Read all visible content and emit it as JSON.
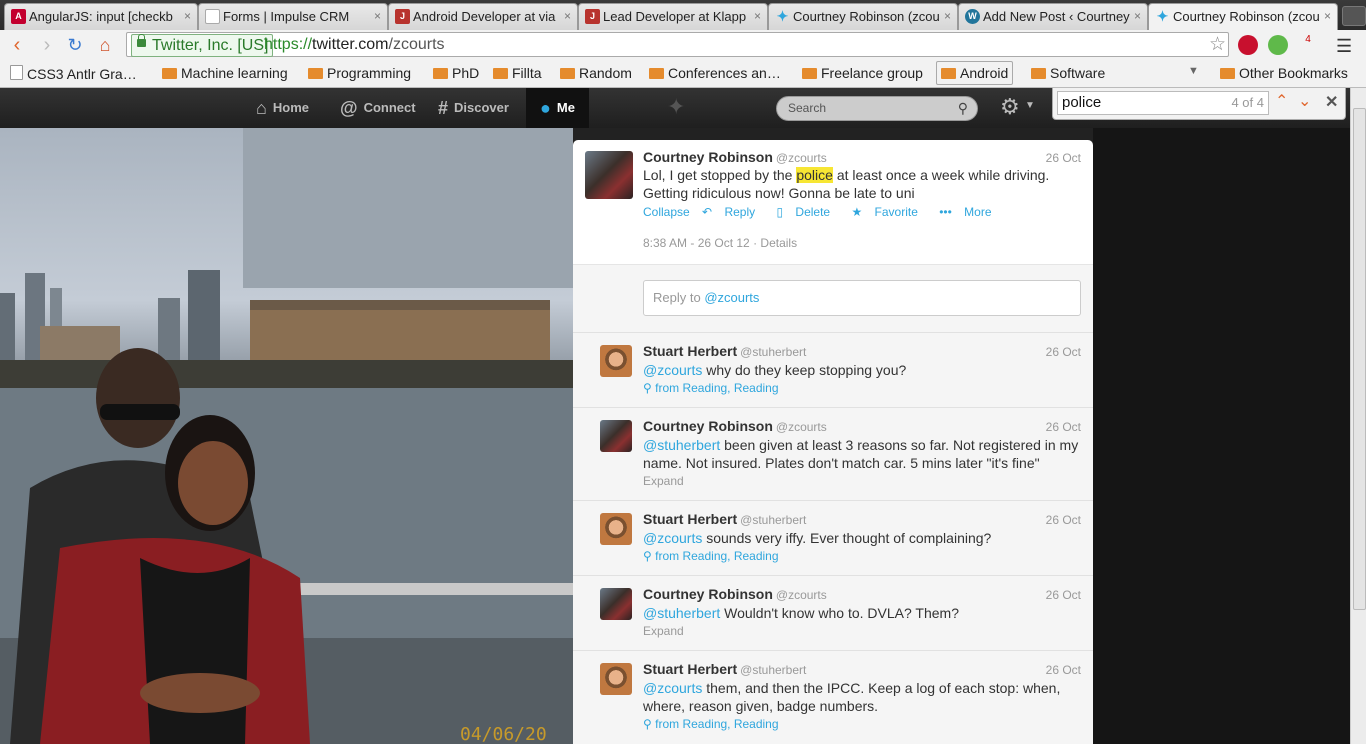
{
  "browser": {
    "tabs": [
      {
        "title": "AngularJS: input [checkb",
        "icon": "angular-icon",
        "color": "#c3002f"
      },
      {
        "title": "Forms | Impulse CRM",
        "icon": "page-icon",
        "color": "#ffffff"
      },
      {
        "title": "Android Developer at via",
        "icon": "jobpage-icon",
        "color": "#b8332e"
      },
      {
        "title": "Lead Developer at Klapp",
        "icon": "jobpage-icon",
        "color": "#b8332e"
      },
      {
        "title": "Courtney Robinson (zcou",
        "icon": "twitter-icon",
        "color": "#2fa6dd"
      },
      {
        "title": "Add New Post ‹ Courtney",
        "icon": "wordpress-icon",
        "color": "#21759b"
      },
      {
        "title": "Courtney Robinson (zcou",
        "icon": "twitter-icon",
        "color": "#2fa6dd"
      }
    ],
    "tab_close": "×",
    "cert": "Twitter, Inc. [US]",
    "url_scheme": "https://",
    "url_host": "twitter.com",
    "url_path": "/zcourts",
    "ext_badge": "4",
    "bookmarks": [
      {
        "label": "CSS3 Antlr Gra…",
        "icon": "page-icon"
      },
      {
        "label": "Machine learning",
        "icon": "folder-icon"
      },
      {
        "label": "Programming",
        "icon": "folder-icon"
      },
      {
        "label": "PhD",
        "icon": "folder-icon"
      },
      {
        "label": "Fillta",
        "icon": "folder-icon"
      },
      {
        "label": "Random",
        "icon": "folder-icon"
      },
      {
        "label": "Conferences an…",
        "icon": "folder-icon"
      },
      {
        "label": "Freelance group",
        "icon": "folder-icon"
      },
      {
        "label": "Android",
        "icon": "folder-icon"
      },
      {
        "label": "Software",
        "icon": "folder-icon"
      }
    ],
    "other_bookmarks": "Other Bookmarks"
  },
  "twitter": {
    "nav": {
      "home": "Home",
      "connect": "Connect",
      "discover": "Discover",
      "me": "Me"
    },
    "search_placeholder": "Search"
  },
  "findbar": {
    "query": "police",
    "count": "4 of 4"
  },
  "main_tweet": {
    "name": "Courtney Robinson",
    "handle": "@zcourts",
    "date": "26 Oct",
    "text_before": "Lol, I get stopped by the ",
    "highlight": "police",
    "text_after": " at least once a week while driving. Getting ridiculous now! Gonna be late to uni",
    "actions": {
      "collapse": "Collapse",
      "reply": "Reply",
      "delete": "Delete",
      "favorite": "Favorite",
      "more": "More"
    },
    "timestamp": "8:38 AM - 26 Oct 12",
    "details": "Details",
    "reply_prefix": "Reply to ",
    "reply_mention": "@zcourts"
  },
  "replies": [
    {
      "name": "Stuart Herbert",
      "handle": "@stuherbert",
      "date": "26 Oct",
      "mention": "@zcourts",
      "text": " why do they keep stopping you?",
      "meta": "from Reading, Reading",
      "meta_kind": "location",
      "avatar": "stuart"
    },
    {
      "name": "Courtney Robinson",
      "handle": "@zcourts",
      "date": "26 Oct",
      "mention": "@stuherbert",
      "text": " been given at least 3 reasons so far. Not registered in my name. Not insured. Plates don't match car. 5 mins later \"it's fine\"",
      "meta": "Expand",
      "meta_kind": "expand",
      "avatar": "courtney"
    },
    {
      "name": "Stuart Herbert",
      "handle": "@stuherbert",
      "date": "26 Oct",
      "mention": "@zcourts",
      "text": " sounds very iffy. Ever thought of complaining?",
      "meta": "from Reading, Reading",
      "meta_kind": "location",
      "avatar": "stuart"
    },
    {
      "name": "Courtney Robinson",
      "handle": "@zcourts",
      "date": "26 Oct",
      "mention": "@stuherbert",
      "text": " Wouldn't know who to. DVLA? Them?",
      "meta": "Expand",
      "meta_kind": "expand",
      "avatar": "courtney"
    },
    {
      "name": "Stuart Herbert",
      "handle": "@stuherbert",
      "date": "26 Oct",
      "mention": "@zcourts",
      "text": " them, and then the IPCC. Keep a log of each stop: when, where, reason given, badge numbers.",
      "meta": "from Reading, Reading",
      "meta_kind": "location",
      "avatar": "stuart"
    }
  ],
  "photo_stamp": "04/06/20"
}
